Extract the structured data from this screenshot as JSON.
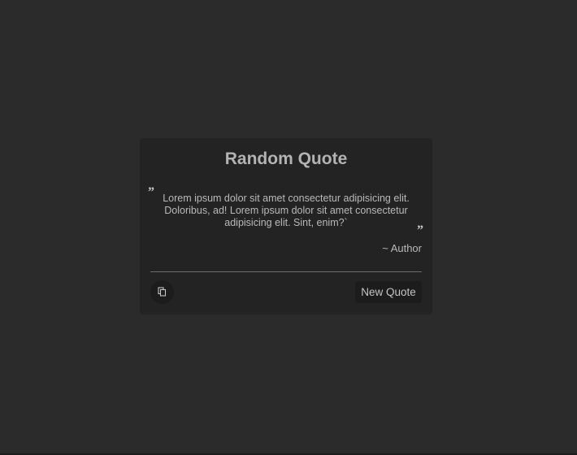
{
  "card": {
    "title": "Random Quote",
    "quote_open_mark": "”",
    "quote_close_mark": "”",
    "quote_text": "Lorem ipsum dolor sit amet consectetur adipisicing elit. Doloribus, ad! Lorem ipsum dolor sit amet consectetur adipisicing elit. Sint, enim?`",
    "author": "~ Author"
  },
  "actions": {
    "copy_icon": "copy-icon",
    "new_quote_label": "New Quote"
  },
  "colors": {
    "background": "#2b2b2b",
    "card": "#232323",
    "text": "#b9b9b9",
    "button": "#1c1c1c"
  }
}
